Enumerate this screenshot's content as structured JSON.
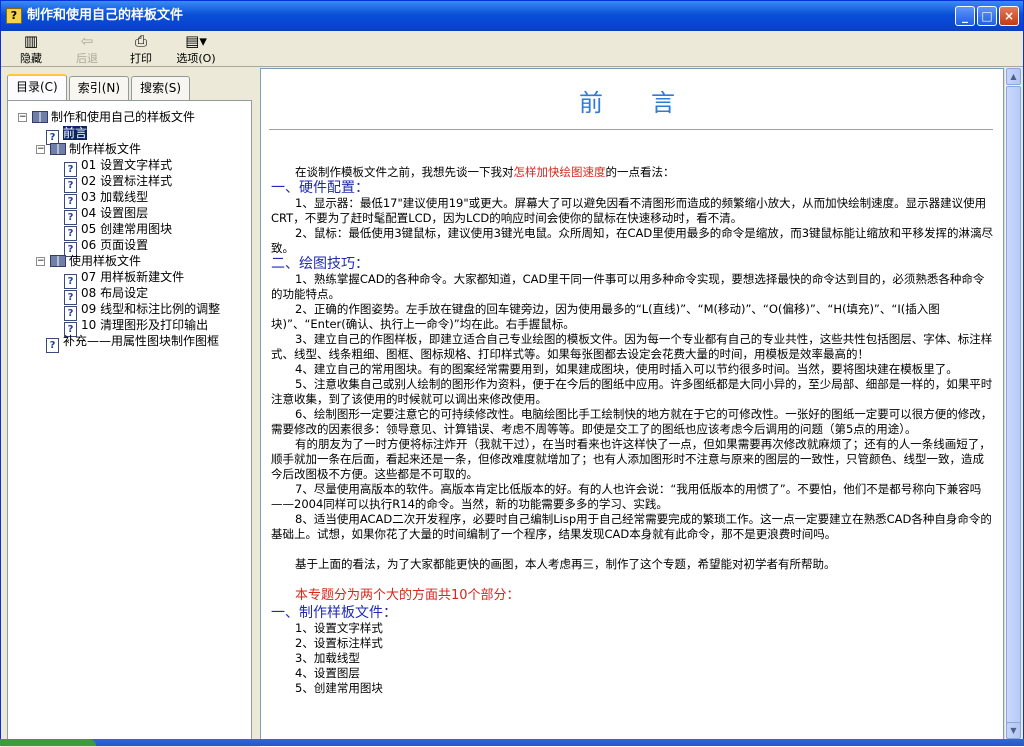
{
  "window": {
    "title": "制作和使用自己的样板文件"
  },
  "toolbar": [
    {
      "label": "隐藏",
      "icon": "hide-icon",
      "enabled": true
    },
    {
      "label": "后退",
      "icon": "back-icon",
      "enabled": false
    },
    {
      "label": "打印",
      "icon": "print-icon",
      "enabled": true
    },
    {
      "label": "选项(O)",
      "icon": "options-icon",
      "enabled": true
    }
  ],
  "tabs": [
    "目录(C)",
    "索引(N)",
    "搜索(S)"
  ],
  "tree": [
    {
      "level": 0,
      "type": "book",
      "expanded": true,
      "label": "制作和使用自己的样板文件"
    },
    {
      "level": 1,
      "type": "page",
      "label": "前言",
      "selected": true
    },
    {
      "level": 1,
      "type": "book",
      "expanded": true,
      "label": "制作样板文件"
    },
    {
      "level": 2,
      "type": "page",
      "label": "01 设置文字样式"
    },
    {
      "level": 2,
      "type": "page",
      "label": "02 设置标注样式"
    },
    {
      "level": 2,
      "type": "page",
      "label": "03 加载线型"
    },
    {
      "level": 2,
      "type": "page",
      "label": "04 设置图层"
    },
    {
      "level": 2,
      "type": "page",
      "label": "05 创建常用图块"
    },
    {
      "level": 2,
      "type": "page",
      "label": "06 页面设置"
    },
    {
      "level": 1,
      "type": "book",
      "expanded": true,
      "label": "使用样板文件"
    },
    {
      "level": 2,
      "type": "page",
      "label": "07 用样板新建文件"
    },
    {
      "level": 2,
      "type": "page",
      "label": "08 布局设定"
    },
    {
      "level": 2,
      "type": "page",
      "label": "09 线型和标注比例的调整"
    },
    {
      "level": 2,
      "type": "page",
      "label": "10 清理图形及打印输出"
    },
    {
      "level": 1,
      "type": "page",
      "label": "补充——用属性图块制作图框"
    }
  ],
  "content": {
    "heading": "前言",
    "intro_pre": "在谈制作模板文件之前，我想先谈一下我对",
    "intro_red": "怎样加快绘图速度",
    "intro_post": "的一点看法：",
    "sec1": "一、硬件配置：",
    "p1": "1、显示器：最低17\"建议使用19\"或更大。屏幕大了可以避免因看不清图形而造成的频繁缩小放大，从而加快绘制速度。显示器建议使用CRT，不要为了赶时髦配置LCD，因为LCD的响应时间会使你的鼠标在快速移动时，看不清。",
    "p2": "2、鼠标：最低使用3键鼠标，建议使用3键光电鼠。众所周知，在CAD里使用最多的命令是缩放，而3键鼠标能让缩放和平移发挥的淋漓尽致。",
    "sec2": "二、绘图技巧：",
    "p3": "1、熟练掌握CAD的各种命令。大家都知道，CAD里干同一件事可以用多种命令实现，要想选择最快的命令达到目的，必须熟悉各种命令的功能特点。",
    "p4": "2、正确的作图姿势。左手放在键盘的回车键旁边，因为使用最多的“L(直线)”、“M(移动)”、“O(偏移)”、“H(填充)”、“I(插入图块)”、“Enter(确认、执行上一命令)”均在此。右手握鼠标。",
    "p5": "3、建立自己的作图样板，即建立适合自己专业绘图的模板文件。因为每一个专业都有自己的专业共性，这些共性包括图层、字体、标注样式、线型、线条粗细、图框、图标规格、打印样式等。如果每张图都去设定会花费大量的时间，用模板是效率最高的！",
    "p6": "4、建立自己的常用图块。有的图案经常需要用到，如果建成图块，使用时插入可以节约很多时间。当然，要将图块建在模板里了。",
    "p7": "5、注意收集自己或别人绘制的图形作为资料，便于在今后的图纸中应用。许多图纸都是大同小异的，至少局部、细部是一样的，如果平时注意收集，到了该使用的时候就可以调出来修改使用。",
    "p8": "6、绘制图形一定要注意它的可持续修改性。电脑绘图比手工绘制快的地方就在于它的可修改性。一张好的图纸一定要可以很方便的修改，需要修改的因素很多：领导意见、计算错误、考虑不周等等。即使是交工了的图纸也应该考虑今后调用的问题（第5点的用途）。",
    "p9": "有的朋友为了一时方便将标注炸开（我就干过），在当时看来也许这样快了一点，但如果需要再次修改就麻烦了；还有的人一条线画短了，顺手就加一条在后面，看起来还是一条，但修改难度就增加了；也有人添加图形时不注意与原来的图层的一致性，只管颜色、线型一致，造成今后改图极不方便。这些都是不可取的。",
    "p10": "7、尽量使用高版本的软件。高版本肯定比低版本的好。有的人也许会说：“我用低版本的用惯了”。不要怕，他们不是都号称向下兼容吗——2004同样可以执行R14的命令。当然，新的功能需要多多的学习、实践。",
    "p11": "8、适当使用ACAD二次开发程序，必要时自己编制Lisp用于自己经常需要完成的繁琐工作。这一点一定要建立在熟悉CAD各种自身命令的基础上。试想，如果你花了大量的时间编制了一个程序，结果发现CAD本身就有此命令，那不是更浪费时间吗。",
    "p12": "基于上面的看法，为了大家都能更快的画图，本人考虑再三，制作了这个专题，希望能对初学者有所帮助。",
    "red_line": "本专题分为两个大的方面共10个部分：",
    "sec3": "一、制作样板文件：",
    "list": [
      "1、设置文字样式",
      "2、设置标注样式",
      "3、加载线型",
      "4、设置图层",
      "5、创建常用图块"
    ]
  }
}
